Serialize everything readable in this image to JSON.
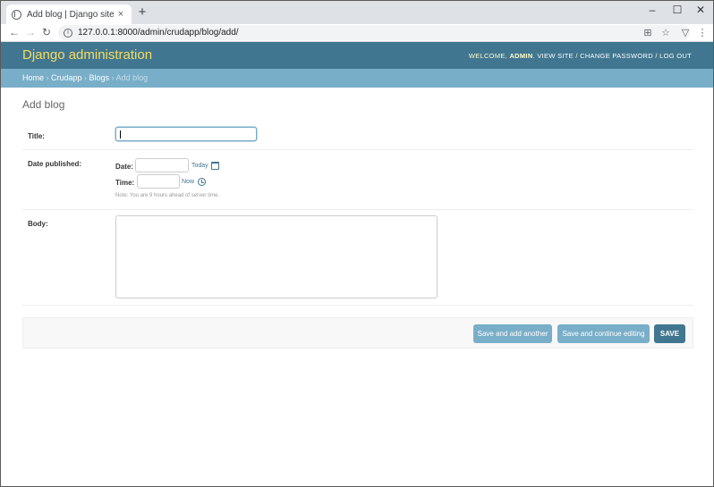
{
  "browser": {
    "tab_title": "Add blog | Django site admin",
    "tab_close": "×",
    "new_tab": "+",
    "url": "127.0.0.1:8000/admin/crudapp/blog/add/",
    "window_controls": {
      "minimize": "–",
      "maximize": "☐",
      "close": "✕"
    },
    "nav": {
      "back": "←",
      "forward": "→",
      "reload": "↻"
    }
  },
  "header": {
    "branding": "Django administration",
    "welcome": "Welcome,",
    "user": "admin",
    "view_site": "View site",
    "change_password": "Change password",
    "log_out": "Log out",
    "separator": " / "
  },
  "breadcrumbs": {
    "home": "Home",
    "app": "Crudapp",
    "model": "Blogs",
    "current": "Add blog",
    "sep": " › "
  },
  "page": {
    "title": "Add blog"
  },
  "form": {
    "title_label": "Title:",
    "title_value": "",
    "date_published_label": "Date published:",
    "date_label": "Date:",
    "date_value": "",
    "today_link": "Today",
    "time_label": "Time:",
    "time_value": "",
    "now_link": "Now",
    "timezone_note": "Note: You are 9 hours ahead of server time.",
    "body_label": "Body:",
    "body_value": ""
  },
  "actions": {
    "save_add_another": "Save and add another",
    "save_continue": "Save and continue editing",
    "save": "SAVE"
  },
  "colors": {
    "header_bg": "#417690",
    "breadcrumbs_bg": "#79aec8",
    "branding_text": "#f5dd5d"
  }
}
